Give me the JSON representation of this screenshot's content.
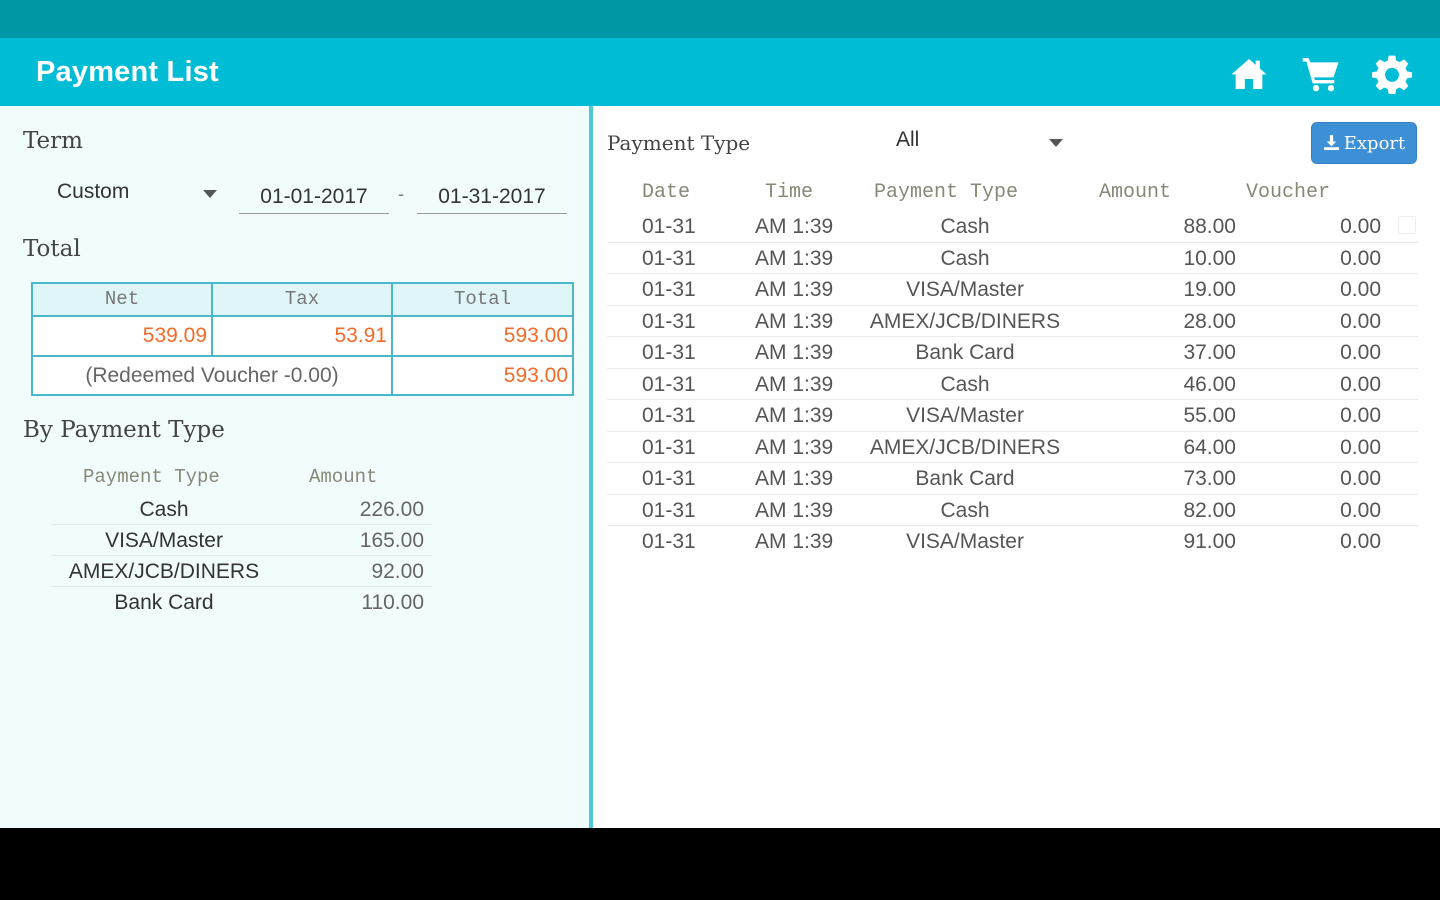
{
  "app_bar": {
    "title": "Payment List",
    "icons": [
      "home-icon",
      "cart-icon",
      "gear-icon"
    ],
    "background": "#00bcd4",
    "status_bar_color": "#0097a7"
  },
  "left": {
    "term_label": "Term",
    "term_select": "Custom",
    "date_from": "01-01-2017",
    "date_separator": "-",
    "date_to": "01-31-2017",
    "total_label": "Total",
    "totals": {
      "headers": [
        "Net",
        "Tax",
        "Total"
      ],
      "net": "539.09",
      "tax": "53.91",
      "total": "593.00",
      "voucher_note": "(Redeemed Voucher -0.00)",
      "grand_total": "593.00",
      "accent_color": "#f26b28"
    },
    "by_payment_type_label": "By Payment Type",
    "by_payment_type": {
      "headers": {
        "type": "Payment Type",
        "amount": "Amount"
      },
      "rows": [
        {
          "type": "Cash",
          "amount": "226.00"
        },
        {
          "type": "VISA/Master",
          "amount": "165.00"
        },
        {
          "type": "AMEX/JCB/DINERS",
          "amount": "92.00"
        },
        {
          "type": "Bank Card",
          "amount": "110.00"
        }
      ]
    }
  },
  "right": {
    "filter_label": "Payment Type",
    "filter_value": "All",
    "export_label": "Export",
    "export_color": "#3d8fd6",
    "columns": {
      "date": "Date",
      "time": "Time",
      "type": "Payment Type",
      "amount": "Amount",
      "voucher": "Voucher"
    },
    "rows": [
      {
        "date": "01-31",
        "time": "AM 1:39",
        "type": "Cash",
        "amount": "88.00",
        "voucher": "0.00"
      },
      {
        "date": "01-31",
        "time": "AM 1:39",
        "type": "Cash",
        "amount": "10.00",
        "voucher": "0.00"
      },
      {
        "date": "01-31",
        "time": "AM 1:39",
        "type": "VISA/Master",
        "amount": "19.00",
        "voucher": "0.00"
      },
      {
        "date": "01-31",
        "time": "AM 1:39",
        "type": "AMEX/JCB/DINERS",
        "amount": "28.00",
        "voucher": "0.00"
      },
      {
        "date": "01-31",
        "time": "AM 1:39",
        "type": "Bank Card",
        "amount": "37.00",
        "voucher": "0.00"
      },
      {
        "date": "01-31",
        "time": "AM 1:39",
        "type": "Cash",
        "amount": "46.00",
        "voucher": "0.00"
      },
      {
        "date": "01-31",
        "time": "AM 1:39",
        "type": "VISA/Master",
        "amount": "55.00",
        "voucher": "0.00"
      },
      {
        "date": "01-31",
        "time": "AM 1:39",
        "type": "AMEX/JCB/DINERS",
        "amount": "64.00",
        "voucher": "0.00"
      },
      {
        "date": "01-31",
        "time": "AM 1:39",
        "type": "Bank Card",
        "amount": "73.00",
        "voucher": "0.00"
      },
      {
        "date": "01-31",
        "time": "AM 1:39",
        "type": "Cash",
        "amount": "82.00",
        "voucher": "0.00"
      },
      {
        "date": "01-31",
        "time": "AM 1:39",
        "type": "VISA/Master",
        "amount": "91.00",
        "voucher": "0.00"
      }
    ]
  }
}
